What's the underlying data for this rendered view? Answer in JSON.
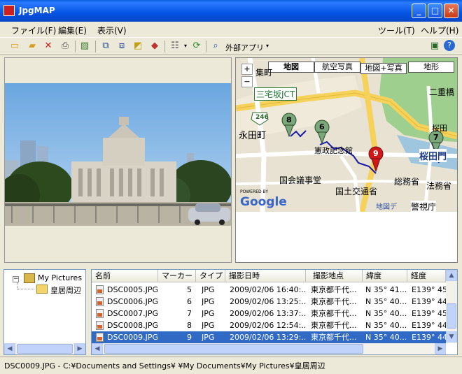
{
  "window": {
    "title": "JpgMAP"
  },
  "menu": {
    "file": "ファイル(F)",
    "edit": "編集(E)",
    "view": "表示(V)",
    "tools": "ツール(T)",
    "help": "ヘルプ(H)"
  },
  "toolbar": {
    "external_app": "外部アプリ"
  },
  "map": {
    "tabs": [
      "地図",
      "航空写真",
      "地図+写真",
      "地形"
    ],
    "zoom_in": "+",
    "zoom_out": "−",
    "labels": [
      "集町",
      "三宅坂JCT",
      "二重橋",
      "246",
      "永田町",
      "憲政記念館",
      "桜田門",
      "国会議事堂",
      "国土交通省",
      "総務省",
      "法務省",
      "桜田",
      "地図デ",
      "POWERED BY",
      "Google"
    ],
    "markers": [
      "8",
      "6",
      "9",
      "7"
    ],
    "building_label": "警視庁"
  },
  "tree": {
    "root": "My Pictures",
    "child": "皇居周辺"
  },
  "list": {
    "columns": [
      "名前",
      "マーカー",
      "タイプ",
      "撮影日時",
      "撮影地点",
      "緯度",
      "経度"
    ],
    "rows": [
      [
        "DSC0005.JPG",
        "5",
        "JPG",
        "2009/02/06 16:40:...",
        "東京都千代...",
        "N 35° 41...",
        "E139° 45"
      ],
      [
        "DSC0006.JPG",
        "6",
        "JPG",
        "2009/02/06 13:25:...",
        "東京都千代...",
        "N 35° 40...",
        "E139° 44"
      ],
      [
        "DSC0007.JPG",
        "7",
        "JPG",
        "2009/02/06 13:37:...",
        "東京都千代...",
        "N 35° 40...",
        "E139° 45"
      ],
      [
        "DSC0008.JPG",
        "8",
        "JPG",
        "2009/02/06 12:54:...",
        "東京都千代...",
        "N 35° 40...",
        "E139° 44"
      ],
      [
        "DSC0009.JPG",
        "9",
        "JPG",
        "2009/02/06 13:29:...",
        "東京都千代...",
        "N 35° 40...",
        "E139° 44"
      ]
    ],
    "selected_index": 4
  },
  "status": {
    "text": "DSC0009.JPG - C:¥Documents and Settings¥      ¥My Documents¥My Pictures¥皇居周辺"
  },
  "colors": {
    "title_bar": "#0553e3",
    "selection": "#316ac5",
    "marker_green": "#5a8f5a",
    "marker_red": "#d01818"
  }
}
